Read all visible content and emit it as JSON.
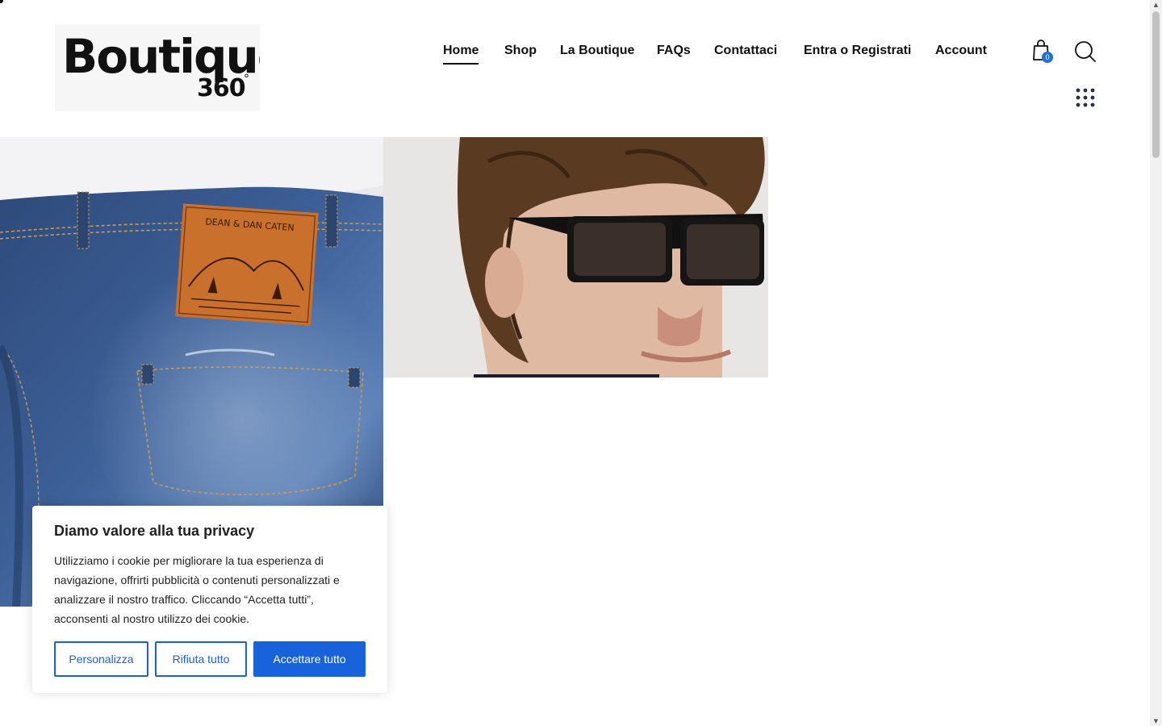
{
  "brand": {
    "word": "Boutique",
    "number": "360",
    "degree": "°"
  },
  "nav": {
    "items": [
      {
        "label": "Home",
        "active": true
      },
      {
        "label": "Shop",
        "active": false
      },
      {
        "label": "La Boutique",
        "active": false
      },
      {
        "label": "FAQs",
        "active": false
      },
      {
        "label": "Contattaci",
        "active": false
      },
      {
        "label": "Entra o Registrati",
        "active": false
      },
      {
        "label": "Account",
        "active": false
      }
    ]
  },
  "header_icons": {
    "cart": "shopping-bag-icon",
    "cart_count": "0",
    "search": "search-icon",
    "menu": "grid-dots-icon"
  },
  "images": {
    "left": "jeans-back-pocket-photo",
    "right": "sunglasses-model-photo"
  },
  "cookie_banner": {
    "title": "Diamo valore alla tua privacy",
    "text": "Utilizziamo i cookie per migliorare la tua esperienza di navigazione, offrirti pubblicità o contenuti personalizzati e analizzare il nostro traffico. Cliccando “Accetta tutti”, acconsenti al nostro utilizzo dei cookie.",
    "buttons": {
      "customize": "Personalizza",
      "reject": "Rifiuta tutto",
      "accept": "Accettare tutto"
    }
  },
  "colors": {
    "accent": "#1863dc",
    "badge": "#1e6fd9",
    "text": "#111111"
  }
}
